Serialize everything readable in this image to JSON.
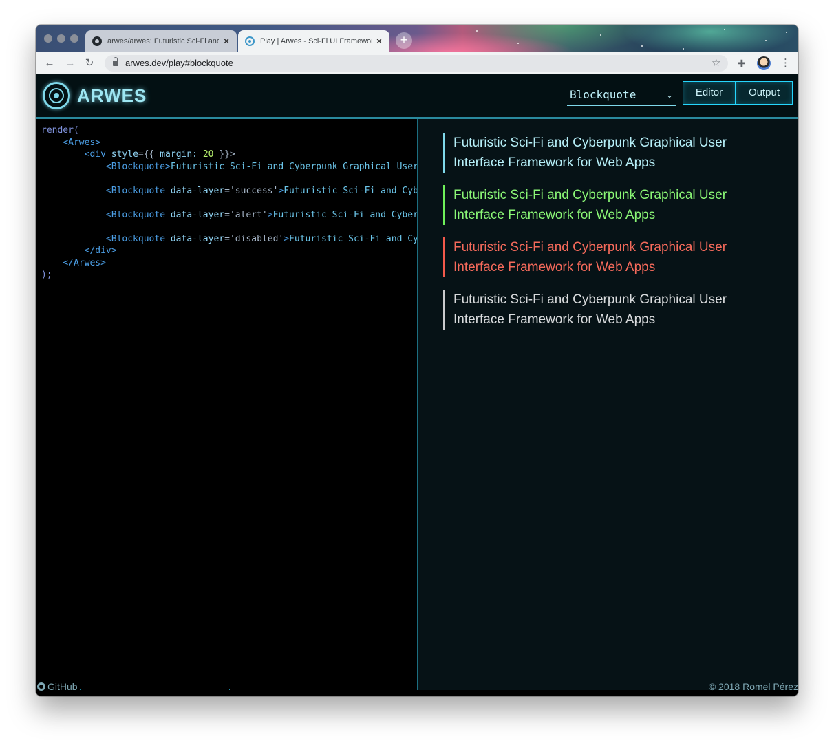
{
  "browser": {
    "tabs": [
      {
        "title": "arwes/arwes: Futuristic Sci-Fi and Cyberpunk",
        "icon": "github-icon",
        "active": false
      },
      {
        "title": "Play | Arwes - Sci-Fi UI Framework",
        "icon": "arwes-icon",
        "active": true
      }
    ],
    "tab_close_glyph": "✕",
    "new_tab_glyph": "+",
    "url": "arwes.dev/play#blockquote",
    "nav": {
      "back": "←",
      "forward": "→",
      "reload": "↻"
    },
    "bookmark_glyph": "☆",
    "extension_glyph": "✚",
    "menu_glyph": "⋮"
  },
  "header": {
    "logo_text": "ARWES",
    "select_value": "Blockquote",
    "select_chevron": "⌄",
    "editor_label": "Editor",
    "output_label": "Output",
    "accent": "#26d6fd"
  },
  "editor": {
    "lines": [
      [
        {
          "c": "kw",
          "t": "render("
        }
      ],
      [
        {
          "c": "txt",
          "t": "    "
        },
        {
          "c": "tag",
          "t": "<Arwes>"
        }
      ],
      [
        {
          "c": "txt",
          "t": "        "
        },
        {
          "c": "tag",
          "t": "<div "
        },
        {
          "c": "attr",
          "t": "style"
        },
        {
          "c": "str",
          "t": "={{ "
        },
        {
          "c": "attr",
          "t": "margin: "
        },
        {
          "c": "num",
          "t": "20"
        },
        {
          "c": "str",
          "t": " }}>"
        }
      ],
      [
        {
          "c": "txt",
          "t": "            "
        },
        {
          "c": "tag",
          "t": "<Blockquote>"
        },
        {
          "c": "txt",
          "t": "Futuristic Sci-Fi and Cyberpunk Graphical User"
        }
      ],
      [
        {
          "c": "txt",
          "t": ""
        }
      ],
      [
        {
          "c": "txt",
          "t": "            "
        },
        {
          "c": "tag",
          "t": "<Blockquote "
        },
        {
          "c": "attr",
          "t": "data-layer"
        },
        {
          "c": "str",
          "t": "='success'"
        },
        {
          "c": "tag",
          "t": ">"
        },
        {
          "c": "txt",
          "t": "Futuristic Sci-Fi and Cybe"
        }
      ],
      [
        {
          "c": "txt",
          "t": ""
        }
      ],
      [
        {
          "c": "txt",
          "t": "            "
        },
        {
          "c": "tag",
          "t": "<Blockquote "
        },
        {
          "c": "attr",
          "t": "data-layer"
        },
        {
          "c": "str",
          "t": "='alert'"
        },
        {
          "c": "tag",
          "t": ">"
        },
        {
          "c": "txt",
          "t": "Futuristic Sci-Fi and Cyberp"
        }
      ],
      [
        {
          "c": "txt",
          "t": ""
        }
      ],
      [
        {
          "c": "txt",
          "t": "            "
        },
        {
          "c": "tag",
          "t": "<Blockquote "
        },
        {
          "c": "attr",
          "t": "data-layer"
        },
        {
          "c": "str",
          "t": "='disabled'"
        },
        {
          "c": "tag",
          "t": ">"
        },
        {
          "c": "txt",
          "t": "Futuristic Sci-Fi and Cyb"
        }
      ],
      [
        {
          "c": "txt",
          "t": "        "
        },
        {
          "c": "tag",
          "t": "</div>"
        }
      ],
      [
        {
          "c": "txt",
          "t": "    "
        },
        {
          "c": "tag",
          "t": "</Arwes>"
        }
      ],
      [
        {
          "c": "kw",
          "t": ");"
        }
      ]
    ]
  },
  "output": {
    "blockquotes": [
      {
        "layer": "primary",
        "text": "Futuristic Sci-Fi and Cyberpunk Graphical User Interface Framework for Web Apps",
        "color": "#7fd8ea"
      },
      {
        "layer": "success",
        "text": "Futuristic Sci-Fi and Cyberpunk Graphical User Interface Framework for Web Apps",
        "color": "#6ef05a"
      },
      {
        "layer": "alert",
        "text": "Futuristic Sci-Fi and Cyberpunk Graphical User Interface Framework for Web Apps",
        "color": "#f2594b"
      },
      {
        "layer": "disabled",
        "text": "Futuristic Sci-Fi and Cyberpunk Graphical User Interface Framework for Web Apps",
        "color": "#c9cbcd"
      }
    ]
  },
  "footer": {
    "github_label": "GitHub",
    "copyright": "© 2018 Romel Pérez"
  }
}
